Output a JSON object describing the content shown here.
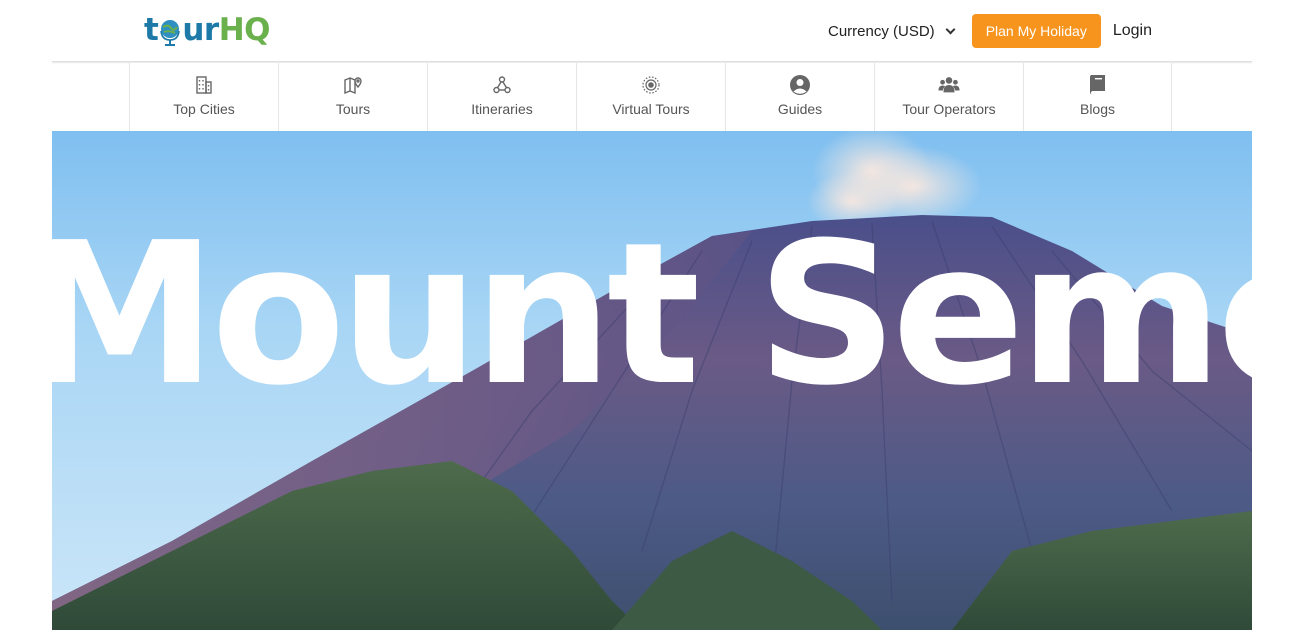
{
  "brand": {
    "logo_text": "tourHQ",
    "logo_parts": {
      "t": "t",
      "ur": "ur",
      "hq": "HQ"
    }
  },
  "header": {
    "currency_label": "Currency (USD)",
    "plan_button": "Plan My Holiday",
    "login_label": "Login"
  },
  "nav": {
    "items": [
      {
        "label": "Top Cities",
        "icon": "building-icon"
      },
      {
        "label": "Tours",
        "icon": "map-pin-icon"
      },
      {
        "label": "Itineraries",
        "icon": "route-nodes-icon"
      },
      {
        "label": "Virtual Tours",
        "icon": "360-view-icon"
      },
      {
        "label": "Guides",
        "icon": "user-circle-icon"
      },
      {
        "label": "Tour Operators",
        "icon": "users-group-icon"
      },
      {
        "label": "Blogs",
        "icon": "book-icon"
      }
    ]
  },
  "hero": {
    "title": "Mount Semeru",
    "image": "volcano-landscape"
  },
  "colors": {
    "accent_orange": "#f7941d",
    "logo_blue": "#1d7aa8",
    "logo_green": "#6ab04c"
  }
}
